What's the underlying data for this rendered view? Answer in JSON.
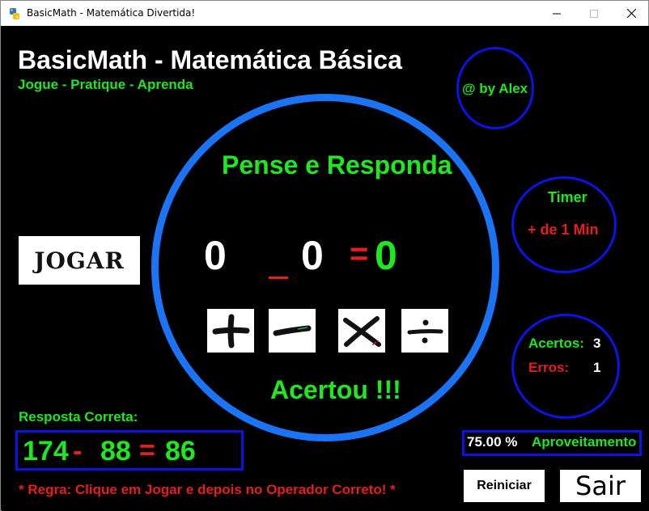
{
  "window": {
    "title": "BasicMath - Matemática Divertida!",
    "icon": "python-icon"
  },
  "header": {
    "title": "BasicMath - Matemática Básica",
    "subtitle": "Jogue - Pratique - Aprenda",
    "author": "@ by Alex"
  },
  "game": {
    "prompt": "Pense e Responda",
    "operand1": "0",
    "operand2": "0",
    "equals": "=",
    "result": "0",
    "feedback": "Acertou !!!",
    "operators": [
      {
        "name": "plus",
        "icon": "plus-icon"
      },
      {
        "name": "minus",
        "icon": "minus-icon"
      },
      {
        "name": "times",
        "icon": "times-icon"
      },
      {
        "name": "divide",
        "icon": "divide-icon"
      }
    ]
  },
  "controls": {
    "play_label": "JOGAR",
    "restart_label": "Reiniciar",
    "exit_label": "Sair"
  },
  "timer": {
    "title": "Timer",
    "value": "+ de 1 Min"
  },
  "score": {
    "hits_label": "Acertos:",
    "hits": "3",
    "errors_label": "Erros:",
    "errors": "1"
  },
  "answer": {
    "title": "Resposta Correta:",
    "a": "174",
    "op": "-",
    "b": "88",
    "eq": "=",
    "c": "86"
  },
  "performance": {
    "value": "75.00 %",
    "label": "Aproveitamento"
  },
  "rule": "* Regra: Clique em Jogar e depois no Operador Correto! *",
  "colors": {
    "background": "#000000",
    "green": "#1ee81e",
    "red": "#e61e1e",
    "blue_ring": "#1a74f5",
    "dark_blue": "#0b14e8"
  }
}
